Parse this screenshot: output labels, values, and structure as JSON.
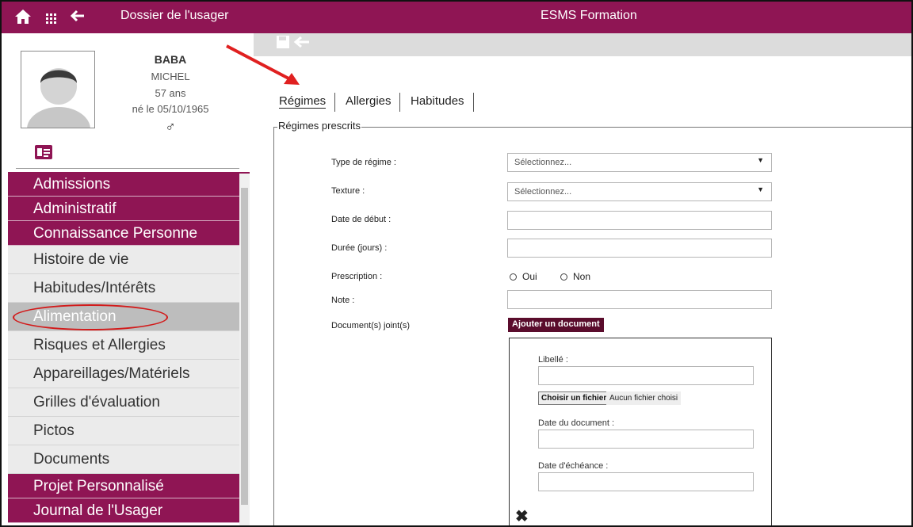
{
  "topbar": {
    "breadcrumb": "Dossier de l'usager",
    "app_title": "ESMS Formation",
    "icons": [
      "home-icon",
      "grid-icon",
      "back-arrow-icon"
    ],
    "color": "#8f1554"
  },
  "patient": {
    "last_name": "BABA",
    "first_name": "MICHEL",
    "age": "57 ans",
    "birth": "né le 05/10/1965",
    "gender_symbol": "♂"
  },
  "sidebar": {
    "items": [
      {
        "label": "Admissions",
        "type": "category"
      },
      {
        "label": "Administratif",
        "type": "category"
      },
      {
        "label": "Connaissance Personne",
        "type": "category"
      },
      {
        "label": "Histoire de vie",
        "type": "sub"
      },
      {
        "label": "Habitudes/Intérêts",
        "type": "sub"
      },
      {
        "label": "Alimentation",
        "type": "sub",
        "active": true
      },
      {
        "label": "Risques et Allergies",
        "type": "sub"
      },
      {
        "label": "Appareillages/Matériels",
        "type": "sub"
      },
      {
        "label": "Grilles d'évaluation",
        "type": "sub"
      },
      {
        "label": "Pictos",
        "type": "sub"
      },
      {
        "label": "Documents",
        "type": "sub"
      },
      {
        "label": "Projet Personnalisé",
        "type": "category"
      },
      {
        "label": "Journal de l'Usager",
        "type": "category"
      }
    ]
  },
  "main": {
    "toolbar_icons": [
      "save-icon",
      "back-arrow-icon"
    ],
    "tabs": [
      {
        "label": "Régimes",
        "active": true
      },
      {
        "label": "Allergies"
      },
      {
        "label": "Habitudes"
      }
    ],
    "fieldset_legend": "Régimes prescrits",
    "form": {
      "type_regime_label": "Type de régime :",
      "type_regime_value": "Sélectionnez...",
      "texture_label": "Texture :",
      "texture_value": "Sélectionnez...",
      "date_debut_label": "Date de début :",
      "duree_label": "Durée (jours) :",
      "prescription_label": "Prescription :",
      "prescription_yes": "Oui",
      "prescription_no": "Non",
      "note_label": "Note :",
      "documents_label": "Document(s) joint(s)",
      "add_document_label": "Ajouter un document"
    },
    "document": {
      "libelle_label": "Libellé :",
      "file_button": "Choisir un fichier",
      "file_status": "Aucun fichier choisi",
      "date_doc_label": "Date du document :",
      "date_echeance_label": "Date d'échéance :"
    }
  }
}
